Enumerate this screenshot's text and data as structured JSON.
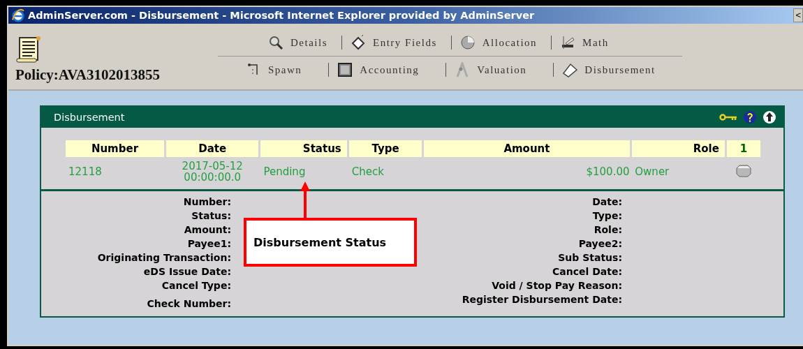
{
  "window": {
    "title": "AdminServer.com - Disbursement - Microsoft Internet Explorer provided by AdminServer",
    "edge_button": "<"
  },
  "header": {
    "policy": "Policy:AVA3102013855"
  },
  "nav_rows": [
    [
      {
        "label": "Details"
      },
      {
        "label": "Entry Fields"
      },
      {
        "label": "Allocation"
      },
      {
        "label": "Math"
      }
    ],
    [
      {
        "label": "Spawn"
      },
      {
        "label": "Accounting"
      },
      {
        "label": "Valuation"
      },
      {
        "label": "Disbursement"
      }
    ]
  ],
  "panel": {
    "title": "Disbursement",
    "table": {
      "columns": [
        "Number",
        "Date",
        "Status",
        "Type",
        "Amount",
        "Role",
        "1"
      ],
      "rows": [
        {
          "number": "12118",
          "date": [
            "2017-05-12",
            "00:00:00.0"
          ],
          "status": "Pending",
          "type": "Check",
          "amount": "$100.00",
          "role": "Owner"
        }
      ]
    },
    "details_left": [
      "Number:",
      "Status:",
      "Amount:",
      "Payee1:",
      "Originating Transaction:",
      "eDS Issue Date:",
      "Cancel Type:",
      "Check Number:"
    ],
    "details_right": [
      "Date:",
      "Type:",
      "Role:",
      "Payee2:",
      "Sub Status:",
      "Cancel Date:",
      "Void / Stop Pay Reason:",
      "Register Disbursement Date:"
    ]
  },
  "callout": {
    "text": "Disbursement Status"
  }
}
